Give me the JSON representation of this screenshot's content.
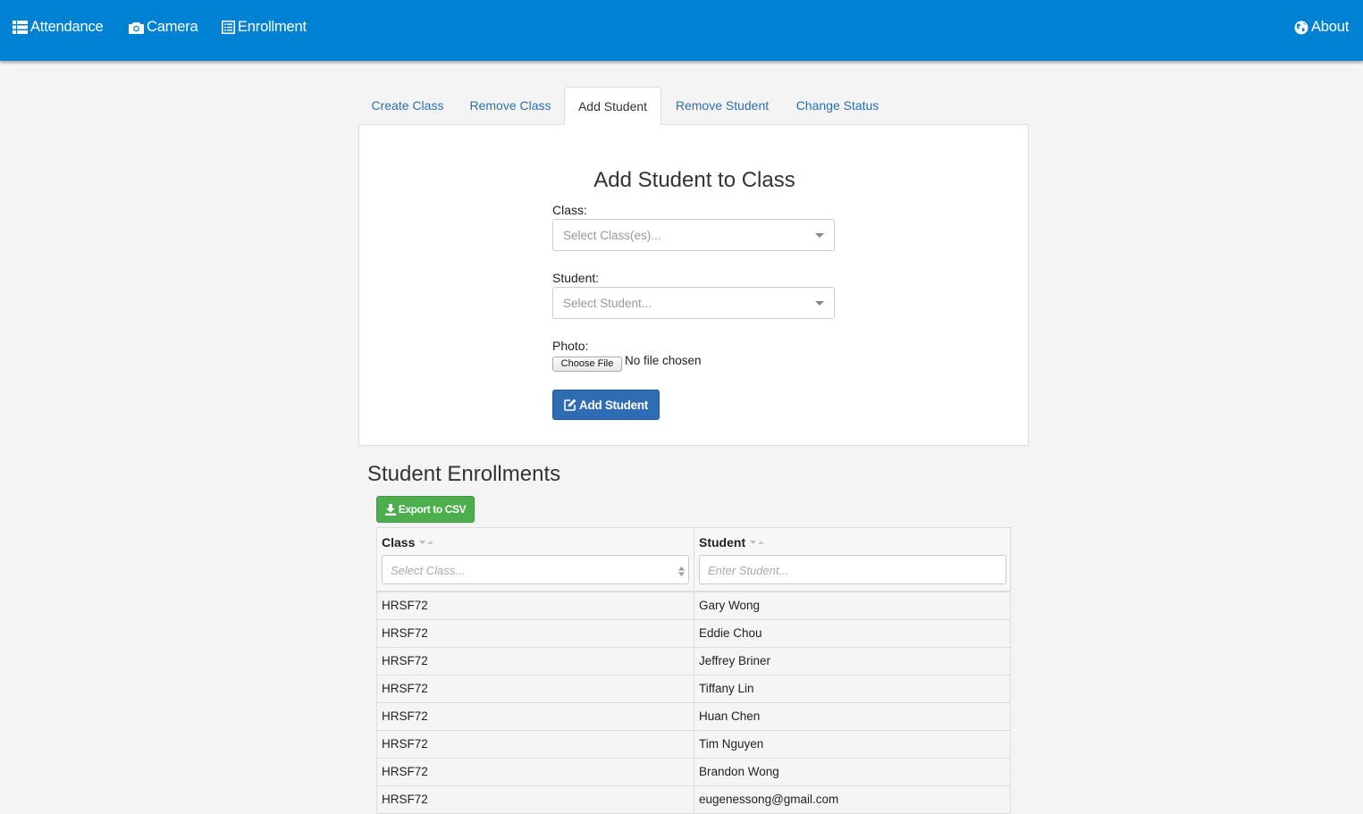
{
  "navbar": {
    "items": [
      {
        "label": "Attendance",
        "icon": "list-icon"
      },
      {
        "label": "Camera",
        "icon": "camera-icon"
      },
      {
        "label": "Enrollment",
        "icon": "list-alt-icon"
      }
    ],
    "about": {
      "label": "About",
      "icon": "globe-icon"
    },
    "background": "#0082d4"
  },
  "tabs": [
    {
      "label": "Create Class",
      "active": false
    },
    {
      "label": "Remove Class",
      "active": false
    },
    {
      "label": "Add Student",
      "active": true
    },
    {
      "label": "Remove Student",
      "active": false
    },
    {
      "label": "Change Status",
      "active": false
    }
  ],
  "form": {
    "title": "Add Student to Class",
    "class_label": "Class:",
    "class_placeholder": "Select Class(es)...",
    "student_label": "Student:",
    "student_placeholder": "Select Student...",
    "photo_label": "Photo:",
    "choose_file": "Choose File",
    "file_status": "No file chosen",
    "submit": "Add Student"
  },
  "enrollments": {
    "title": "Student Enrollments",
    "export_button": "Export to CSV",
    "columns": [
      {
        "header": "Class",
        "filter_placeholder": "Select Class..."
      },
      {
        "header": "Student",
        "filter_placeholder": "Enter Student..."
      }
    ],
    "rows": [
      {
        "class": "HRSF72",
        "student": "Gary Wong"
      },
      {
        "class": "HRSF72",
        "student": "Eddie Chou"
      },
      {
        "class": "HRSF72",
        "student": "Jeffrey Briner"
      },
      {
        "class": "HRSF72",
        "student": "Tiffany Lin"
      },
      {
        "class": "HRSF72",
        "student": "Huan Chen"
      },
      {
        "class": "HRSF72",
        "student": "Tim Nguyen"
      },
      {
        "class": "HRSF72",
        "student": "Brandon Wong"
      },
      {
        "class": "HRSF72",
        "student": "eugenessong@gmail.com"
      }
    ]
  },
  "colors": {
    "primary_button": "#2e6db4",
    "success_button": "#4cae4c",
    "tab_link": "#2a6fb3"
  }
}
